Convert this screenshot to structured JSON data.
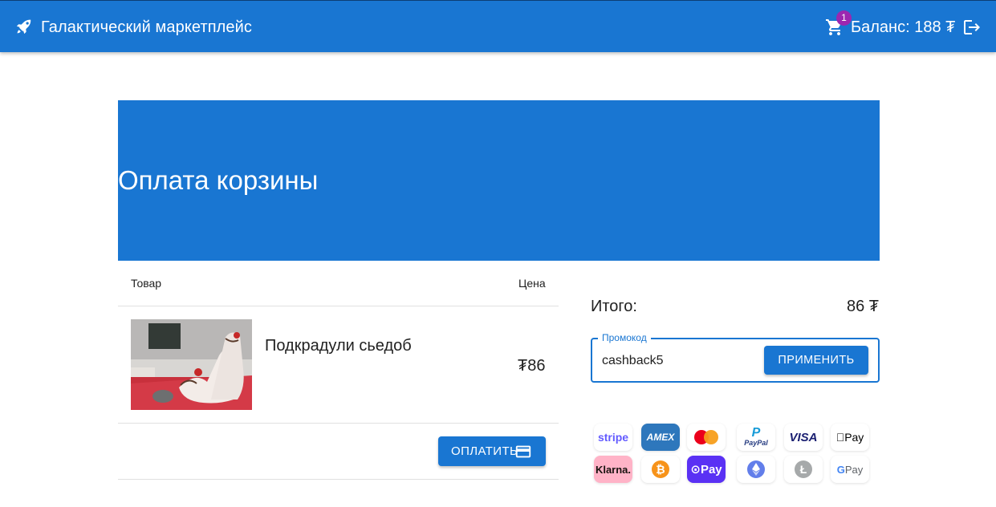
{
  "header": {
    "title": "Галактический маркетплейс",
    "cart_count": "1",
    "balance": "Баланс: 188 ₮",
    "icons": [
      "rocket-icon",
      "cart-icon",
      "logout-icon"
    ]
  },
  "hero": {
    "title": "Оплата корзины"
  },
  "table": {
    "columns": [
      "Товар",
      "Цена"
    ],
    "rows": [
      {
        "name": "Подкрадули сьедоб",
        "price": "₮86"
      }
    ]
  },
  "pay_button": {
    "label": "ОПЛАТИТЬ"
  },
  "summary": {
    "label": "Итого:",
    "value": "86 ₮"
  },
  "promo": {
    "label": "Промокод",
    "value": "cashback5",
    "apply_label": "ПРИМЕНИТЬ"
  },
  "payment_methods": [
    {
      "name": "stripe",
      "text": "stripe"
    },
    {
      "name": "amex",
      "text": "AMEX"
    },
    {
      "name": "mastercard",
      "text": ""
    },
    {
      "name": "paypal",
      "text": "PayPal"
    },
    {
      "name": "visa",
      "text": "VISA"
    },
    {
      "name": "apple-pay",
      "text": "Pay"
    },
    {
      "name": "klarna",
      "text": "Klarna."
    },
    {
      "name": "bitcoin",
      "text": "₿"
    },
    {
      "name": "opay",
      "text": "Pay"
    },
    {
      "name": "ethereum",
      "text": ""
    },
    {
      "name": "litecoin",
      "text": "Ł"
    },
    {
      "name": "google-pay",
      "text": "Pay"
    }
  ],
  "colors": {
    "primary": "#1976d2",
    "badge": "#9c27b0"
  }
}
